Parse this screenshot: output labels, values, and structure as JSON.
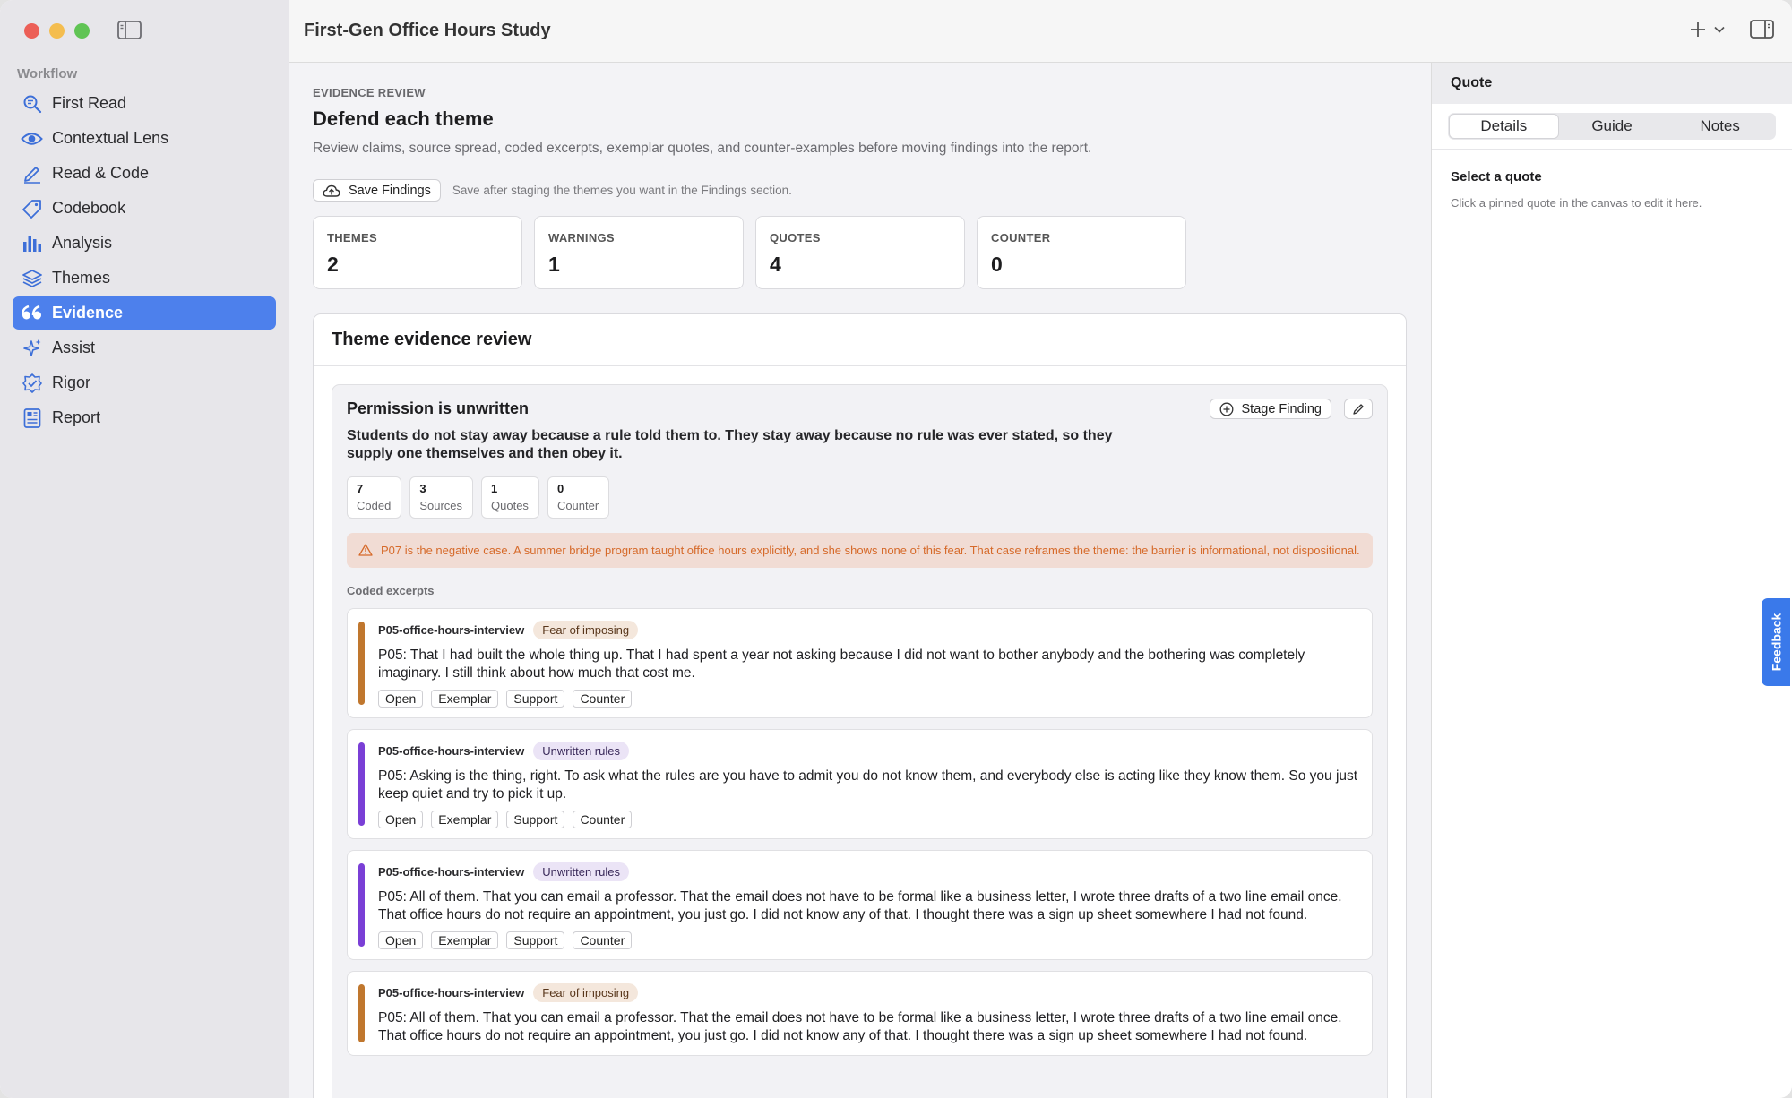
{
  "app": {
    "title": "First-Gen Office Hours Study"
  },
  "sidebar": {
    "section": "Workflow",
    "items": [
      {
        "label": "First Read",
        "icon": "magnifier-icon"
      },
      {
        "label": "Contextual Lens",
        "icon": "eye-icon"
      },
      {
        "label": "Read & Code",
        "icon": "pencil-icon"
      },
      {
        "label": "Codebook",
        "icon": "tag-icon"
      },
      {
        "label": "Analysis",
        "icon": "bar-chart-icon"
      },
      {
        "label": "Themes",
        "icon": "layers-icon"
      },
      {
        "label": "Evidence",
        "icon": "quote-icon",
        "active": true
      },
      {
        "label": "Assist",
        "icon": "sparkle-icon"
      },
      {
        "label": "Rigor",
        "icon": "shield-check-icon"
      },
      {
        "label": "Report",
        "icon": "report-icon"
      }
    ]
  },
  "header": {
    "eyebrow": "EVIDENCE REVIEW",
    "title": "Defend each theme",
    "subtitle": "Review claims, source spread, coded excerpts, exemplar quotes, and counter-examples before moving findings into the report.",
    "save_label": "Save Findings",
    "save_hint": "Save after staging the themes you want in the Findings section."
  },
  "stats": [
    {
      "label": "THEMES",
      "value": "2"
    },
    {
      "label": "WARNINGS",
      "value": "1"
    },
    {
      "label": "QUOTES",
      "value": "4"
    },
    {
      "label": "COUNTER",
      "value": "0"
    }
  ],
  "panel": {
    "title": "Theme evidence review"
  },
  "theme": {
    "title": "Permission is unwritten",
    "claim": "Students do not stay away because a rule told them to. They stay away because no rule was ever stated, so they supply one themselves and then obey it.",
    "stage_label": "Stage Finding",
    "chips": [
      {
        "n": "7",
        "t": "Coded"
      },
      {
        "n": "3",
        "t": "Sources"
      },
      {
        "n": "1",
        "t": "Quotes"
      },
      {
        "n": "0",
        "t": "Counter"
      }
    ],
    "warning": "P07 is the negative case. A summer bridge program taught office hours explicitly, and she shows none of this fear. That case reframes the theme: the barrier is informational, not dispositional.",
    "excerpts_label": "Coded excerpts",
    "buttons": {
      "open": "Open",
      "exemplar": "Exemplar",
      "support": "Support",
      "counter": "Counter"
    },
    "excerpts": [
      {
        "source": "P05-office-hours-interview",
        "code": "Fear of imposing",
        "color": "#c0772e",
        "text": "P05: That I had built the whole thing up. That I had spent a year not asking because I did not want to bother anybody and the bothering was completely imaginary. I still think about how much that cost me."
      },
      {
        "source": "P05-office-hours-interview",
        "code": "Unwritten rules",
        "color": "#7a3fd6",
        "text": "P05: Asking is the thing, right. To ask what the rules are you have to admit you do not know them, and everybody else is acting like they know them. So you just keep quiet and try to pick it up."
      },
      {
        "source": "P05-office-hours-interview",
        "code": "Unwritten rules",
        "color": "#7a3fd6",
        "text": "P05: All of them. That you can email a professor. That the email does not have to be formal like a business letter, I wrote three drafts of a two line email once. That office hours do not require an appointment, you just go. I did not know any of that. I thought there was a sign up sheet somewhere I had not found."
      },
      {
        "source": "P05-office-hours-interview",
        "code": "Fear of imposing",
        "color": "#c0772e",
        "text": "P05: All of them. That you can email a professor. That the email does not have to be formal like a business letter, I wrote three drafts of a two line email once. That office hours do not require an appointment, you just go. I did not know any of that. I thought there was a sign up sheet somewhere I had not found."
      }
    ]
  },
  "inspector": {
    "title": "Quote",
    "tabs": [
      "Details",
      "Guide",
      "Notes"
    ],
    "active_tab": 0,
    "empty_title": "Select a quote",
    "empty_hint": "Click a pinned quote in the canvas to edit it here.",
    "feedback": "Feedback"
  }
}
